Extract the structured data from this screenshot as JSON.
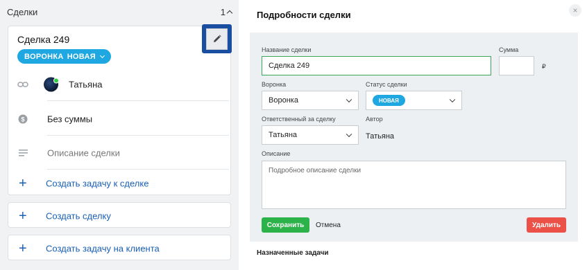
{
  "left": {
    "title": "Сделки",
    "count": "1",
    "deal": {
      "name": "Сделка 249",
      "funnel_label": "ВОРОНКА",
      "stage_label": "НОВАЯ",
      "responsible": "Татьяна",
      "amount": "Без суммы",
      "description": "Описание сделки",
      "create_task_label": "Создать задачу к сделке"
    },
    "create_deal_label": "Создать сделку",
    "create_client_task_label": "Создать задачу на клиента"
  },
  "details": {
    "title": "Подробности сделки",
    "close": "×",
    "name_label": "Название сделки",
    "name_value": "Сделка 249",
    "sum_label": "Сумма",
    "sum_value": "",
    "currency": "₽",
    "funnel_label": "Воронка",
    "funnel_value": "Воронка",
    "status_label": "Статус сделки",
    "status_value": "НОВАЯ",
    "responsible_label": "Ответственный за сделку",
    "responsible_value": "Татьяна",
    "author_label": "Автор",
    "author_value": "Татьяна",
    "description_label": "Описание",
    "description_placeholder": "Подробное описание сделки",
    "save_label": "Сохранить",
    "cancel_label": "Отмена",
    "delete_label": "Удалить"
  },
  "assigned_tasks_label": "Назначенные задачи",
  "colors": {
    "accent": "#1fa7e1",
    "link": "#1a5fb4",
    "save": "#2bb34a",
    "delete": "#eb5146",
    "edit_highlight": "#1a4ea1"
  }
}
